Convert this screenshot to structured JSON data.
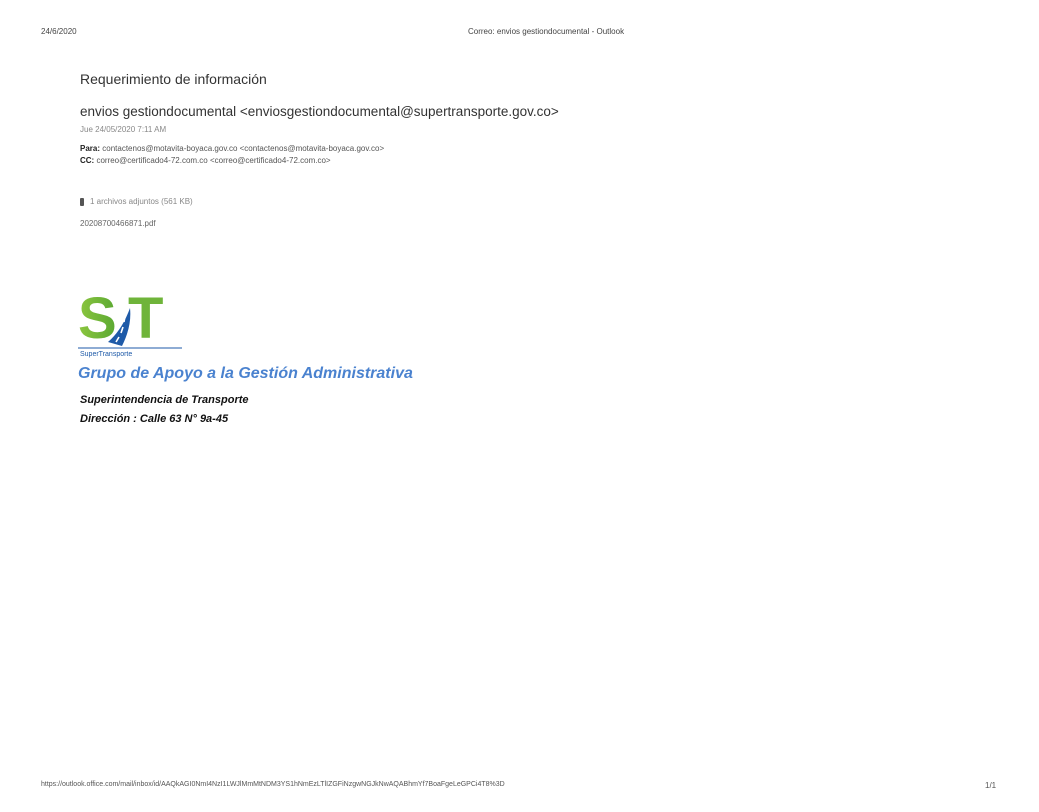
{
  "print_header": {
    "date": "24/6/2020",
    "title": "Correo: envios gestiondocumental - Outlook"
  },
  "email": {
    "subject": "Requerimiento de información",
    "sender": "envios gestiondocumental <enviosgestiondocumental@supertransporte.gov.co>",
    "sent_date": "Jue 24/05/2020 7:11 AM",
    "to_label": "Para:",
    "to_value": "contactenos@motavita-boyaca.gov.co <contactenos@motavita-boyaca.gov.co>",
    "cc_label": "CC:",
    "cc_value": "correo@certificado4-72.com.co <correo@certificado4-72.com.co>",
    "attachments_summary": "1 archivos adjuntos (561 KB)",
    "attachment_file": "20208700466871.pdf"
  },
  "signature": {
    "logo_letters": "ST",
    "logo_caption": "SuperTransporte",
    "group": "Grupo de Apoyo a la Gestión Administrativa",
    "org": "Superintendencia de Transporte",
    "address": "Dirección : Calle 63 N° 9a-45"
  },
  "print_footer": {
    "url": "https://outlook.office.com/mail/inbox/id/AAQkAGI0NmI4NzI1LWJlMmMtNDM3YS1hNmEzLTlIZGFiNzgwNGJkNwAQABhmYf7BoaFgeLeGPCi4T8%3D",
    "page": "1/1"
  },
  "colors": {
    "logo_green": "#8cc63f",
    "logo_blue": "#1e5aa8",
    "group_blue": "#4a82cf"
  }
}
